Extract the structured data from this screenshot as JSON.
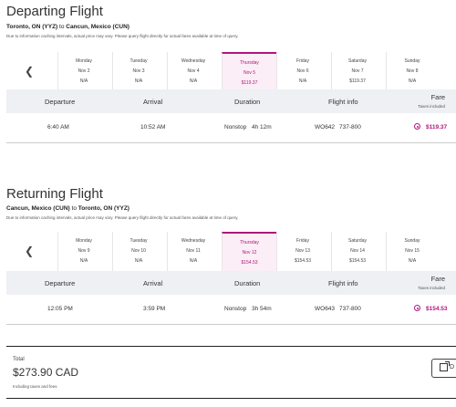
{
  "departing": {
    "title": "Departing Flight",
    "from": "Toronto, ON (YYZ)",
    "to_word": "to",
    "to": "Cancun, Mexico (CUN)",
    "disclaimer": "Due to information caching intervals, actual price may vary. Please query flight directly for actual fares available at time of query.",
    "days": [
      {
        "name": "Monday",
        "date": "Nov 2",
        "price": "N/A"
      },
      {
        "name": "Tuesday",
        "date": "Nov 3",
        "price": "N/A"
      },
      {
        "name": "Wednesday",
        "date": "Nov 4",
        "price": "N/A"
      },
      {
        "name": "Thursday",
        "date": "Nov 5",
        "price": "$119.37"
      },
      {
        "name": "Friday",
        "date": "Nov 6",
        "price": "N/A"
      },
      {
        "name": "Saturday",
        "date": "Nov 7",
        "price": "$119.37"
      },
      {
        "name": "Sunday",
        "date": "Nov 8",
        "price": "N/A"
      }
    ],
    "columns": {
      "departure": "Departure",
      "arrival": "Arrival",
      "duration": "Duration",
      "flight_info": "Flight info",
      "fare": "Fare",
      "taxes": "Taxes included"
    },
    "flight": {
      "departure": "6:40 AM",
      "arrival": "10:52 AM",
      "stops": "Nonstop",
      "duration": "4h 12m",
      "flight_no": "WO642",
      "aircraft": "737-800",
      "fare": "$119.37"
    }
  },
  "returning": {
    "title": "Returning Flight",
    "from": "Cancun, Mexico (CUN)",
    "to_word": "to",
    "to": "Toronto, ON (YYZ)",
    "disclaimer": "Due to information caching intervals, actual price may vary. Please query flight directly for actual fares available at time of query.",
    "days": [
      {
        "name": "Monday",
        "date": "Nov 9",
        "price": "N/A"
      },
      {
        "name": "Tuesday",
        "date": "Nov 10",
        "price": "N/A"
      },
      {
        "name": "Wednesday",
        "date": "Nov 11",
        "price": "N/A"
      },
      {
        "name": "Thursday",
        "date": "Nov 12",
        "price": "$154.53"
      },
      {
        "name": "Friday",
        "date": "Nov 13",
        "price": "$154.53"
      },
      {
        "name": "Saturday",
        "date": "Nov 14",
        "price": "$154.53"
      },
      {
        "name": "Sunday",
        "date": "Nov 15",
        "price": "N/A"
      }
    ],
    "columns": {
      "departure": "Departure",
      "arrival": "Arrival",
      "duration": "Duration",
      "flight_info": "Flight info",
      "fare": "Fare",
      "taxes": "Taxes included"
    },
    "flight": {
      "departure": "12:05 PM",
      "arrival": "3:59 PM",
      "stops": "Nonstop",
      "duration": "3h 54m",
      "flight_no": "WO643",
      "aircraft": "737-800",
      "fare": "$154.53"
    }
  },
  "total": {
    "label": "Total",
    "value": "$273.90 CAD",
    "sub": "Including taxes and fees",
    "button_label": "D"
  },
  "colors": {
    "accent": "#b0167e"
  }
}
